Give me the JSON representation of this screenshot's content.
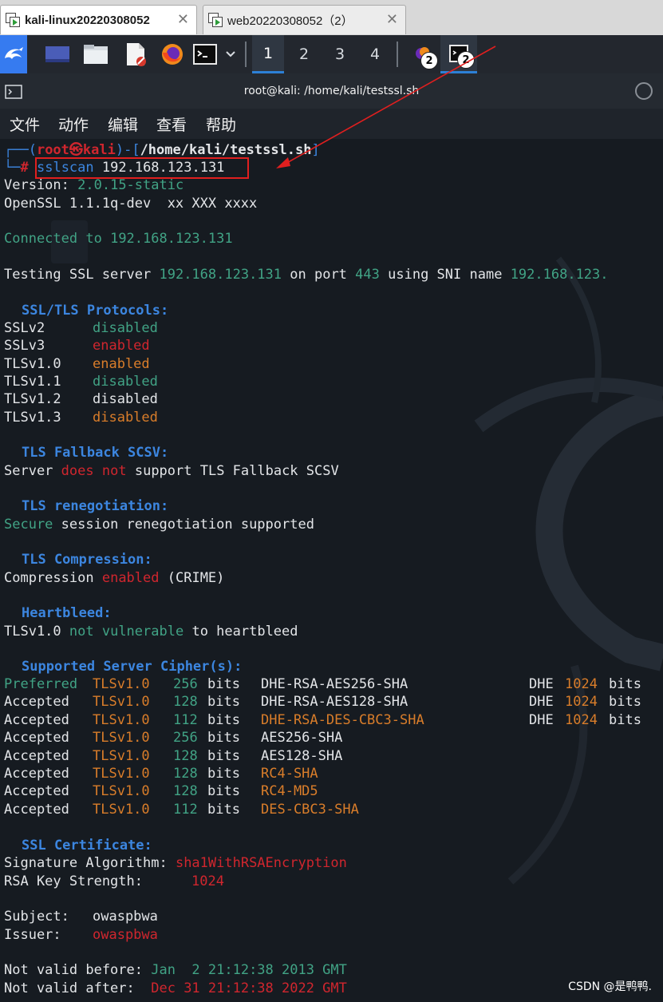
{
  "vm_tabs": [
    {
      "label": "kali-linux20220308052",
      "close": "✕"
    },
    {
      "label": "web20220308052（2）",
      "close": "✕"
    }
  ],
  "panel": {
    "workspaces": [
      "1",
      "2",
      "3",
      "4"
    ],
    "active_workspace": "1",
    "badges": [
      "2",
      "2"
    ]
  },
  "terminal": {
    "title": "root@kali: /home/kali/testssl.sh",
    "menu": [
      "文件",
      "动作",
      "编辑",
      "查看",
      "帮助"
    ]
  },
  "output": {
    "prompt": {
      "line1_prefix": "┌──(",
      "user_host": "root㉿kali",
      "line1_mid": ")-[",
      "path": "/home/kali/testssl.sh",
      "line1_suffix": "]",
      "line2_prefix": "└─",
      "hash": "#",
      "cmd_name": "sslscan",
      "cmd_arg": "192.168.123.131"
    },
    "version": {
      "label": "Version:",
      "value": "2.0.15-static"
    },
    "openssl": "OpenSSL 1.1.1q-dev  xx XXX xxxx",
    "connected": {
      "text": "Connected to",
      "ip": "192.168.123.131"
    },
    "testing": {
      "t1": "Testing SSL server",
      "ip": "192.168.123.131",
      "t2": "on port",
      "port": "443",
      "t3": "using SNI name",
      "sni": "192.168.123."
    },
    "protocols": {
      "heading": "SSL/TLS Protocols:",
      "rows": [
        {
          "name": "SSLv2",
          "status": "disabled",
          "color": "green"
        },
        {
          "name": "SSLv3",
          "status": "enabled",
          "color": "red"
        },
        {
          "name": "TLSv1.0",
          "status": "enabled",
          "color": "orange"
        },
        {
          "name": "TLSv1.1",
          "status": "disabled",
          "color": "green"
        },
        {
          "name": "TLSv1.2",
          "status": "disabled",
          "color": "white"
        },
        {
          "name": "TLSv1.3",
          "status": "disabled",
          "color": "orange"
        }
      ]
    },
    "fallback": {
      "heading": "TLS Fallback SCSV:",
      "t1": "Server",
      "does": "does",
      "not": "not",
      "t2": "support TLS Fallback SCSV"
    },
    "renegotiation": {
      "heading": "TLS renegotiation:",
      "secure": "Secure",
      "text": "session renegotiation supported"
    },
    "compression": {
      "heading": "TLS Compression:",
      "t1": "Compression",
      "enabled": "enabled",
      "t2": "(CRIME)"
    },
    "heartbleed": {
      "heading": "Heartbleed:",
      "proto": "TLSv1.0",
      "status": "not vulnerable",
      "t2": "to heartbleed"
    },
    "ciphers": {
      "heading": "Supported Server Cipher(s):",
      "rows": [
        {
          "status": "Preferred",
          "proto": "TLSv1.0",
          "bits": "256",
          "bits_word": "bits",
          "cipher": "DHE-RSA-AES256-SHA",
          "cipher_color": "white",
          "kx": "DHE",
          "kx_bits": "1024",
          "kx_word": "bits"
        },
        {
          "status": "Accepted",
          "proto": "TLSv1.0",
          "bits": "128",
          "bits_word": "bits",
          "cipher": "DHE-RSA-AES128-SHA",
          "cipher_color": "white",
          "kx": "DHE",
          "kx_bits": "1024",
          "kx_word": "bits"
        },
        {
          "status": "Accepted",
          "proto": "TLSv1.0",
          "bits": "112",
          "bits_word": "bits",
          "cipher": "DHE-RSA-DES-CBC3-SHA",
          "cipher_color": "orange",
          "kx": "DHE",
          "kx_bits": "1024",
          "kx_word": "bits"
        },
        {
          "status": "Accepted",
          "proto": "TLSv1.0",
          "bits": "256",
          "bits_word": "bits",
          "cipher": "AES256-SHA",
          "cipher_color": "white",
          "kx": "",
          "kx_bits": "",
          "kx_word": ""
        },
        {
          "status": "Accepted",
          "proto": "TLSv1.0",
          "bits": "128",
          "bits_word": "bits",
          "cipher": "AES128-SHA",
          "cipher_color": "white",
          "kx": "",
          "kx_bits": "",
          "kx_word": ""
        },
        {
          "status": "Accepted",
          "proto": "TLSv1.0",
          "bits": "128",
          "bits_word": "bits",
          "cipher": "RC4-SHA",
          "cipher_color": "orange",
          "kx": "",
          "kx_bits": "",
          "kx_word": ""
        },
        {
          "status": "Accepted",
          "proto": "TLSv1.0",
          "bits": "128",
          "bits_word": "bits",
          "cipher": "RC4-MD5",
          "cipher_color": "orange",
          "kx": "",
          "kx_bits": "",
          "kx_word": ""
        },
        {
          "status": "Accepted",
          "proto": "TLSv1.0",
          "bits": "112",
          "bits_word": "bits",
          "cipher": "DES-CBC3-SHA",
          "cipher_color": "orange",
          "kx": "",
          "kx_bits": "",
          "kx_word": ""
        }
      ]
    },
    "certificate": {
      "heading": "SSL Certificate:",
      "sig_label": "Signature Algorithm:",
      "sig_value": "sha1WithRSAEncryption",
      "rsa_label": "RSA Key Strength:",
      "rsa_value": "1024",
      "subject_label": "Subject:",
      "subject_value": "owaspbwa",
      "issuer_label": "Issuer:",
      "issuer_value": "owaspbwa",
      "before_label": "Not valid before:",
      "before_value": "Jan  2 21:12:38 2013 GMT",
      "after_label": "Not valid after:",
      "after_value": "Dec 31 21:12:38 2022 GMT"
    }
  },
  "watermark": "CSDN @是鸭鸭.",
  "colors": {
    "green": "#41a385",
    "red": "#d0262e",
    "orange": "#d97d2a",
    "blue": "#3c86e0",
    "white": "#e3e5e8",
    "annotation": "#e01f1f"
  }
}
